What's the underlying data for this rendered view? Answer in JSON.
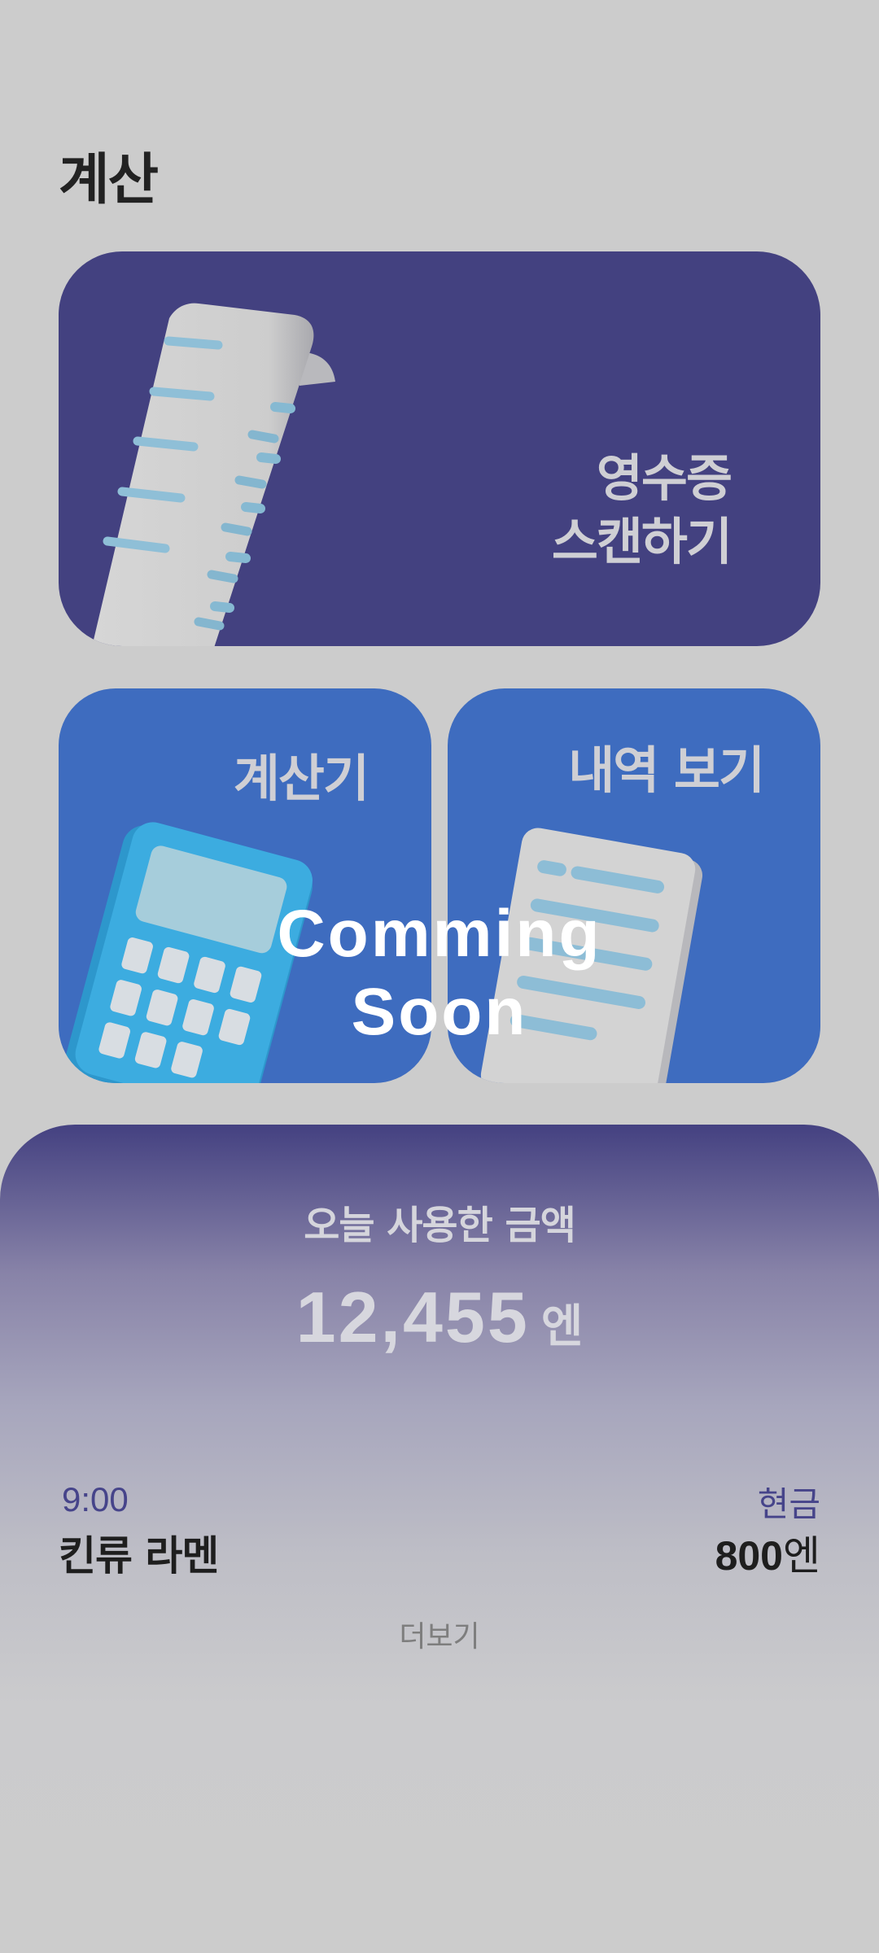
{
  "header": {
    "title": "계산"
  },
  "cards": {
    "scan": {
      "label_line1": "영수증",
      "label_line2": "스캔하기",
      "icon": "receipt-icon"
    },
    "calculator": {
      "label": "계산기",
      "icon": "calculator-icon"
    },
    "history": {
      "label": "내역 보기",
      "icon": "document-icon"
    },
    "overlay": {
      "line1": "Comming",
      "line2": "Soon"
    }
  },
  "summary": {
    "title": "오늘 사용한 금액",
    "amount": "12,455",
    "amount_unit": "엔",
    "entries": [
      {
        "time": "9:00",
        "name": "킨류 라멘",
        "method": "현금",
        "price": "800",
        "price_unit": "엔"
      }
    ],
    "more_label": "더보기"
  },
  "colors": {
    "background": "#cccccc",
    "scan_card": "#434180",
    "small_cards": "#3e6cbf",
    "accent_text": "#46448a"
  }
}
